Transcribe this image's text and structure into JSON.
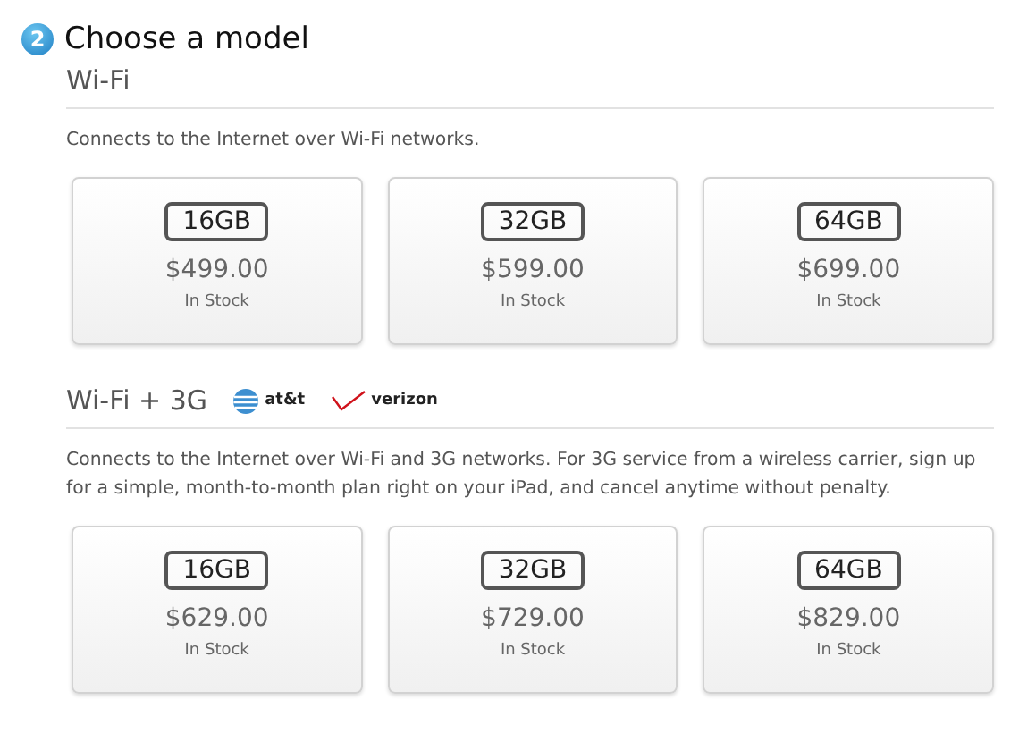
{
  "step": {
    "number": "2",
    "title": "Choose a model"
  },
  "sections": [
    {
      "title": "Wi-Fi",
      "description": "Connects to the Internet over Wi-Fi networks.",
      "models": [
        {
          "capacity": "16GB",
          "price": "$499.00",
          "availability": "In Stock"
        },
        {
          "capacity": "32GB",
          "price": "$599.00",
          "availability": "In Stock"
        },
        {
          "capacity": "64GB",
          "price": "$699.00",
          "availability": "In Stock"
        }
      ]
    },
    {
      "title": "Wi-Fi + 3G",
      "carriers": [
        {
          "kind": "globe",
          "name": "at&t"
        },
        {
          "kind": "check",
          "name": "verizon"
        }
      ],
      "description": "Connects to the Internet over Wi-Fi and 3G networks. For 3G service from a wireless carrier, sign up for a simple, month-to-month plan right on your iPad, and cancel anytime without penalty.",
      "models": [
        {
          "capacity": "16GB",
          "price": "$629.00",
          "availability": "In Stock"
        },
        {
          "capacity": "32GB",
          "price": "$729.00",
          "availability": "In Stock"
        },
        {
          "capacity": "64GB",
          "price": "$829.00",
          "availability": "In Stock"
        }
      ]
    }
  ]
}
